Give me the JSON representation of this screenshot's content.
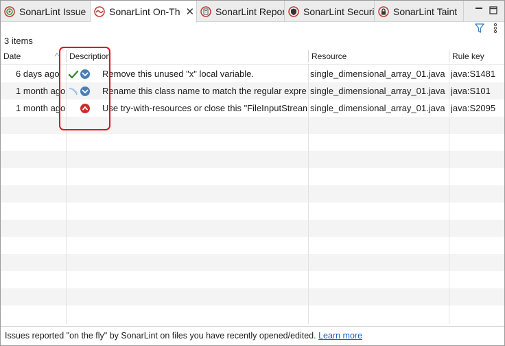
{
  "tabs": [
    {
      "label": "SonarLint Issue",
      "icon": "sonarlint-issues-icon",
      "active": false
    },
    {
      "label": "SonarLint On-Th",
      "icon": "sonarlint-onthefly-icon",
      "active": true
    },
    {
      "label": "SonarLint Repor",
      "icon": "sonarlint-report-icon",
      "active": false
    },
    {
      "label": "SonarLint Securi",
      "icon": "sonarlint-security-icon",
      "active": false
    },
    {
      "label": "SonarLint Taint",
      "icon": "sonarlint-taint-icon",
      "active": false
    }
  ],
  "tab_close_glyph": "✕",
  "toolbar": {
    "count": "3 items"
  },
  "columns": {
    "date": "Date",
    "description": "Description",
    "resource": "Resource",
    "rule_key": "Rule key"
  },
  "rows": [
    {
      "date": "6 days ago",
      "status_icon": "resolved-check-icon",
      "severity_icon": "minor-severity-icon",
      "description": "Remove this unused \"x\" local variable.",
      "resource": "single_dimensional_array_01.java",
      "rule_key": "java:S1481"
    },
    {
      "date": "1 month ago",
      "status_icon": "new-code-icon",
      "severity_icon": "minor-severity-icon",
      "description": "Rename this class name to match the regular expression",
      "resource": "single_dimensional_array_01.java",
      "rule_key": "java:S101"
    },
    {
      "date": "1 month ago",
      "status_icon": "",
      "severity_icon": "blocker-severity-icon",
      "description": "Use try-with-resources or close this \"FileInputStream\"",
      "resource": "single_dimensional_array_01.java",
      "rule_key": "java:S2095"
    }
  ],
  "status_bar": {
    "text": "Issues reported \"on the fly\" by SonarLint on files you have recently opened/edited.",
    "link": "Learn more"
  },
  "colors": {
    "highlight": "#e0141c",
    "link": "#1560c8",
    "minor": "#4a7fb5",
    "blocker": "#d02b2b",
    "check": "#3c8a2e"
  }
}
